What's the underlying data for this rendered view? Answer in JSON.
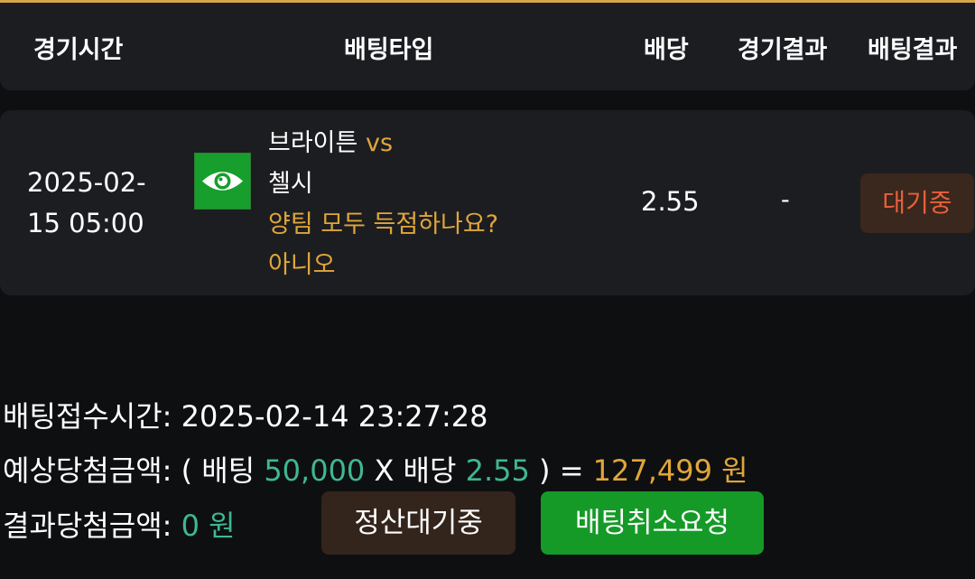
{
  "header": {
    "time_col": "경기시간",
    "type_col": "배팅타입",
    "odds_col": "배당",
    "game_result_col": "경기결과",
    "bet_result_col": "배팅결과"
  },
  "bet": {
    "time_line1": "2025-02-",
    "time_line2": "15 05:00",
    "team_logo_icon": "eye-icon",
    "home_team": "브라이튼",
    "vs": "vs",
    "away_team": "첼시",
    "market": "양팀 모두 득점하나요?",
    "selection": "아니오",
    "odds": "2.55",
    "game_result": "-",
    "status": "대기중"
  },
  "summary": {
    "bet_time_label": "배팅접수시간:",
    "bet_time_value": "2025-02-14 23:27:28",
    "expected_label": "예상당첨금액:",
    "expected_open": "( 배팅",
    "expected_stake": "50,000",
    "expected_x": "X 배당",
    "expected_odds": "2.55",
    "expected_close": ") =",
    "expected_amount": "127,499 원",
    "result_label": "결과당첨금액:",
    "result_amount": "0 원"
  },
  "buttons": {
    "pending_label": "정산대기중",
    "cancel_label": "배팅취소요청"
  },
  "colors": {
    "accent_gold": "#e0a63a",
    "teal": "#3fb88f",
    "status_orange": "#e7603a",
    "button_green": "#159a27"
  }
}
